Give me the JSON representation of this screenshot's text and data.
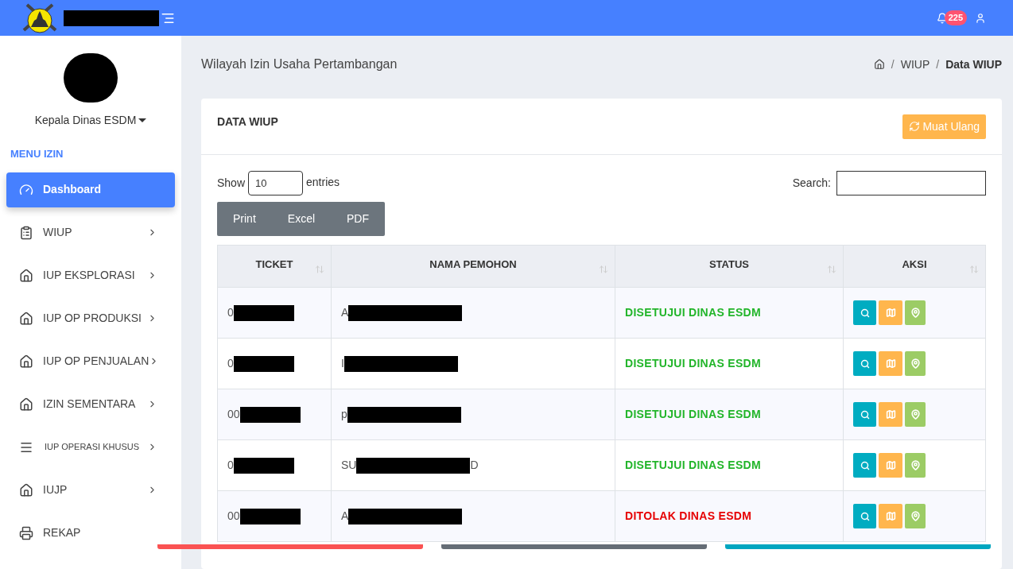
{
  "topbar": {
    "notification_count": "225"
  },
  "sidebar": {
    "user_role": "Kepala Dinas ESDM",
    "menu_title": "MENU IZIN",
    "items": [
      {
        "label": "Dashboard",
        "kind": "dashboard",
        "selected": true,
        "submenu": false,
        "compact": false
      },
      {
        "label": "WIUP",
        "kind": "list",
        "selected": false,
        "submenu": true,
        "compact": false
      },
      {
        "label": "IUP EKSPLORASI",
        "kind": "permit",
        "selected": false,
        "submenu": true,
        "compact": false
      },
      {
        "label": "IUP OP PRODUKSI",
        "kind": "permit",
        "selected": false,
        "submenu": true,
        "compact": false
      },
      {
        "label": "IUP OP PENJUALAN",
        "kind": "permit",
        "selected": false,
        "submenu": true,
        "compact": false
      },
      {
        "label": "IZIN SEMENTARA",
        "kind": "permit",
        "selected": false,
        "submenu": true,
        "compact": false
      },
      {
        "label": "IUP OPERASI KHUSUS",
        "kind": "group",
        "selected": false,
        "submenu": true,
        "compact": true
      },
      {
        "label": "IUJP",
        "kind": "permit",
        "selected": false,
        "submenu": true,
        "compact": false
      },
      {
        "label": "REKAP",
        "kind": "report",
        "selected": false,
        "submenu": false,
        "compact": false
      }
    ]
  },
  "page": {
    "title": "Wilayah Izin Usaha Pertambangan",
    "breadcrumb": [
      {
        "separator": "/",
        "label": "WIUP",
        "current": false
      },
      {
        "separator": "/",
        "label": "Data WIUP",
        "current": true
      }
    ]
  },
  "card": {
    "title": "DATA WIUP",
    "reload_button": "Muat Ulang",
    "show_label": "Show",
    "entries_value": "10",
    "entries_label": "entries",
    "search_label": "Search:",
    "export_buttons": [
      "Print",
      "Excel",
      "PDF"
    ],
    "table": {
      "columns": [
        "TICKET",
        "NAMA PEMOHON",
        "STATUS",
        "AKSI"
      ],
      "rows": [
        {
          "ticket": "0",
          "name": "A",
          "status": "DISETUJUI DINAS ESDM",
          "color": "#22b52a"
        },
        {
          "ticket": "0",
          "name": "I",
          "status": "DISETUJUI DINAS ESDM",
          "color": "#22b52a"
        },
        {
          "ticket": "00",
          "name": "p",
          "status": "DISETUJUI DINAS ESDM",
          "color": "#22b52a"
        },
        {
          "ticket": "0",
          "name": "SU",
          "name_suffix": "D",
          "status": "DISETUJUI DINAS ESDM",
          "color": "#22b52a"
        },
        {
          "ticket": "00",
          "name": "A",
          "status": "DITOLAK DINAS ESDM",
          "color": "#e60000"
        }
      ]
    }
  },
  "bottom_cards": [
    {
      "color": "#fa5252"
    },
    {
      "color": "#656d76"
    },
    {
      "color": "#00a6c0"
    }
  ]
}
